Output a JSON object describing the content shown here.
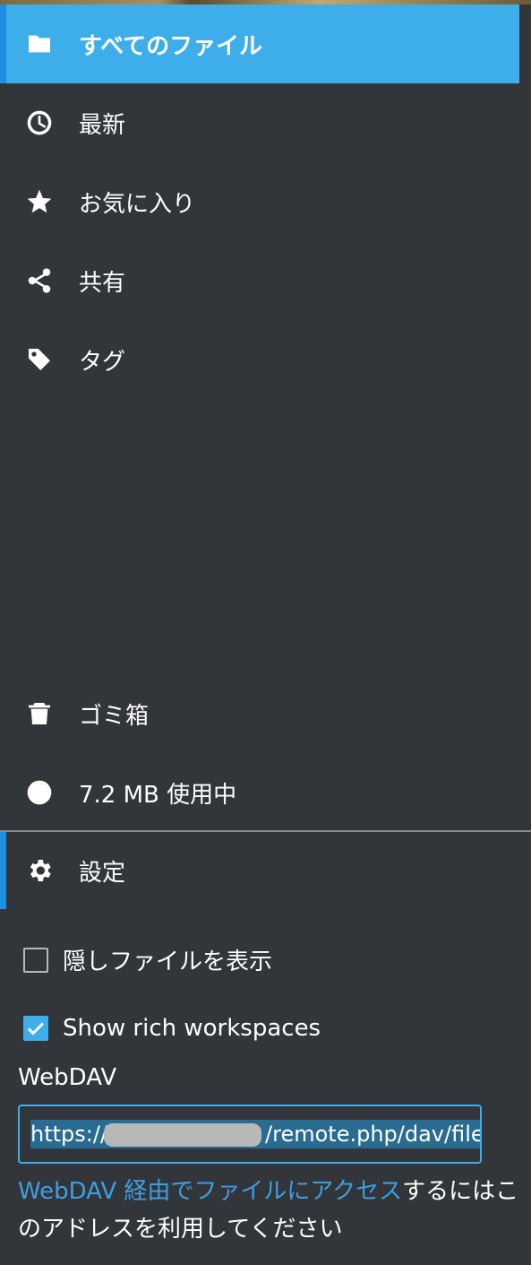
{
  "nav": {
    "all_files": "すべてのファイル",
    "recent": "最新",
    "favorites": "お気に入り",
    "shared": "共有",
    "tags": "タグ",
    "trash": "ゴミ箱",
    "quota": "7.2 MB 使用中",
    "settings": "設定"
  },
  "settings": {
    "show_hidden_label": "隠しファイルを表示",
    "show_hidden_checked": false,
    "show_rich_label": "Show rich workspaces",
    "show_rich_checked": true,
    "webdav_label": "WebDAV",
    "webdav_url_start": "https://",
    "webdav_url_end": "/remote.php/dav/file",
    "webdav_help_link": "WebDAV 経由でファイルにアクセス",
    "webdav_help_rest": "するにはこのアドレスを利用してください"
  },
  "colors": {
    "background": "#32363b",
    "accent": "#3daeea",
    "active_bar": "#1f8fe0",
    "link": "#3d9fe0"
  }
}
